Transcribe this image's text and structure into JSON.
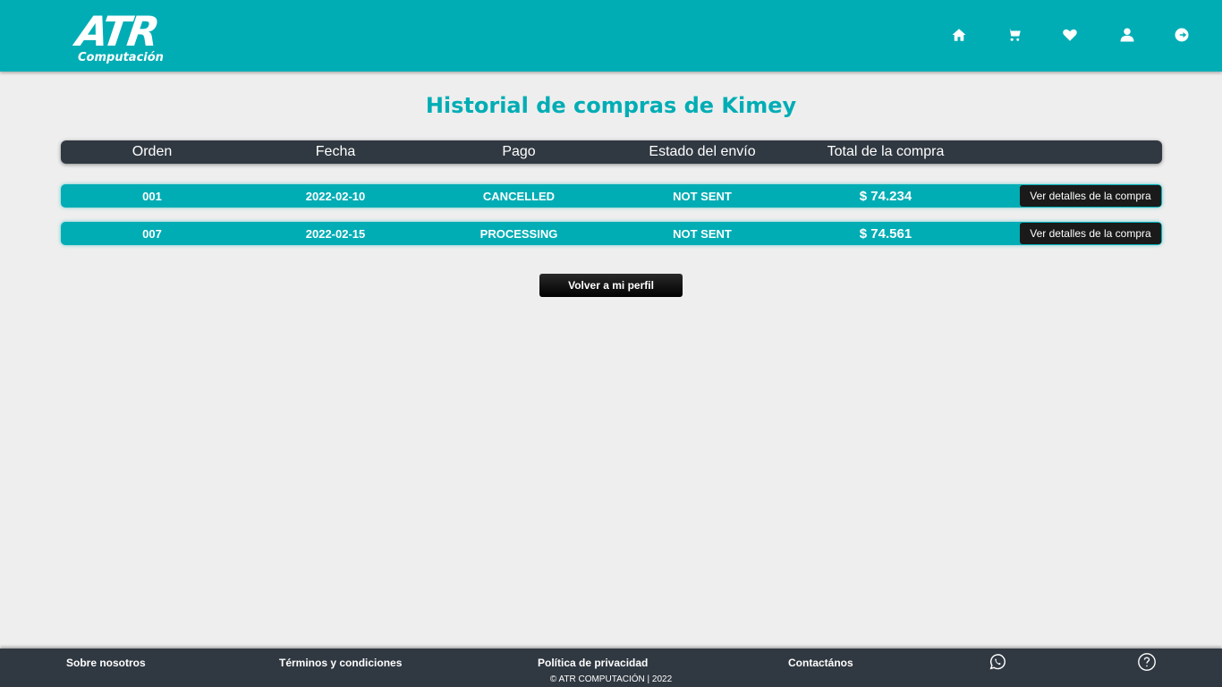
{
  "header": {
    "logo_main": "ATR",
    "logo_sub": "Computación",
    "nav_icons": [
      "home-icon",
      "cart-icon",
      "heart-icon",
      "user-icon",
      "logout-icon"
    ]
  },
  "page": {
    "title": "Historial de compras de Kimey"
  },
  "table": {
    "columns": [
      "Orden",
      "Fecha",
      "Pago",
      "Estado del envío",
      "Total de la compra"
    ],
    "rows": [
      {
        "order": "001",
        "date": "2022-02-10",
        "payment": "CANCELLED",
        "shipping": "NOT SENT",
        "total": "$ 74.234",
        "action": "Ver detalles de la compra"
      },
      {
        "order": "007",
        "date": "2022-02-15",
        "payment": "PROCESSING",
        "shipping": "NOT SENT",
        "total": "$ 74.561",
        "action": "Ver detalles de la compra"
      }
    ]
  },
  "back_button": "Volver a mi perfil",
  "footer": {
    "links": [
      "Sobre nosotros",
      "Términos y condiciones",
      "Política de privacidad",
      "Contactános"
    ],
    "copyright": "© ATR COMPUTACIÓN | 2022",
    "icons": [
      "whatsapp-icon",
      "help-icon"
    ]
  },
  "colors": {
    "brand": "#00adb5",
    "dark": "#303841",
    "background": "#eeeeee"
  }
}
